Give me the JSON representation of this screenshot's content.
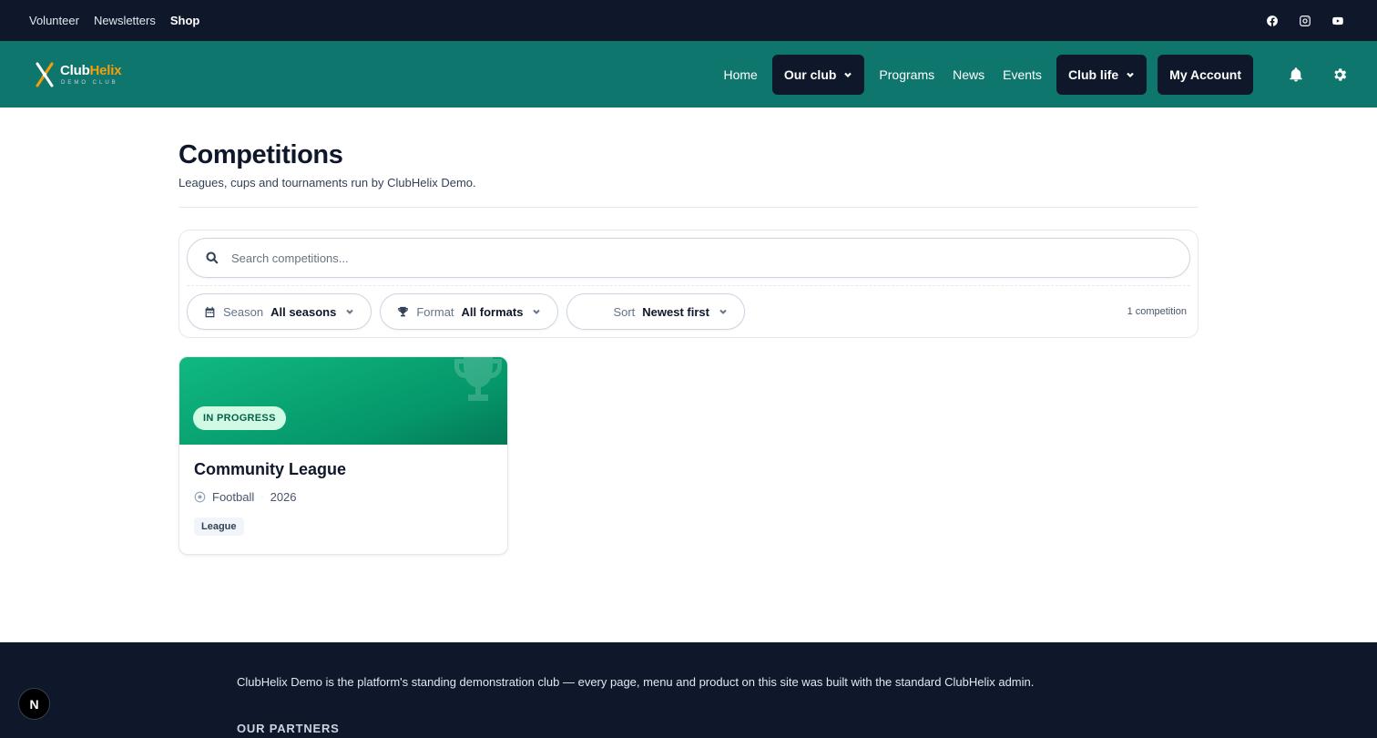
{
  "topbar": {
    "links": [
      "Volunteer",
      "Newsletters",
      "Shop"
    ],
    "social": [
      "facebook-icon",
      "instagram-icon",
      "youtube-icon"
    ]
  },
  "nav": {
    "logo": {
      "name_part1": "Club",
      "name_part2": "Helix",
      "sub": "DEMO CLUB",
      "accent": "#f59e0b"
    },
    "home": "Home",
    "our_club": "Our club",
    "programs": "Programs",
    "news": "News",
    "events": "Events",
    "club_life": "Club life",
    "my_account": "My Account",
    "icons": [
      "bell-icon",
      "gear-icon"
    ]
  },
  "page": {
    "title": "Competitions",
    "subtitle": "Leagues, cups and tournaments run by ClubHelix Demo."
  },
  "search": {
    "placeholder": "Search competitions..."
  },
  "filters": {
    "season": {
      "label": "Season",
      "value": "All seasons"
    },
    "format": {
      "label": "Format",
      "value": "All formats"
    },
    "sort": {
      "label": "Sort",
      "value": "Newest first"
    },
    "count": "1 competition"
  },
  "competitions": [
    {
      "status": "IN PROGRESS",
      "title": "Community League",
      "sport": "Football",
      "year": "2026",
      "tag": "League"
    }
  ],
  "footer": {
    "blurb": "ClubHelix Demo is the platform's standing demonstration club — every page, menu and product on this site was built with the standard ClubHelix admin.",
    "partners_heading": "OUR PARTNERS"
  },
  "dev_button": "N",
  "colors": {
    "topbar_bg": "#0f172a",
    "nav_bg": "#0f766e",
    "pill_bg": "#0f172a",
    "card_banner": "#059669",
    "badge_bg": "#d1fae5",
    "badge_text": "#065f46"
  }
}
